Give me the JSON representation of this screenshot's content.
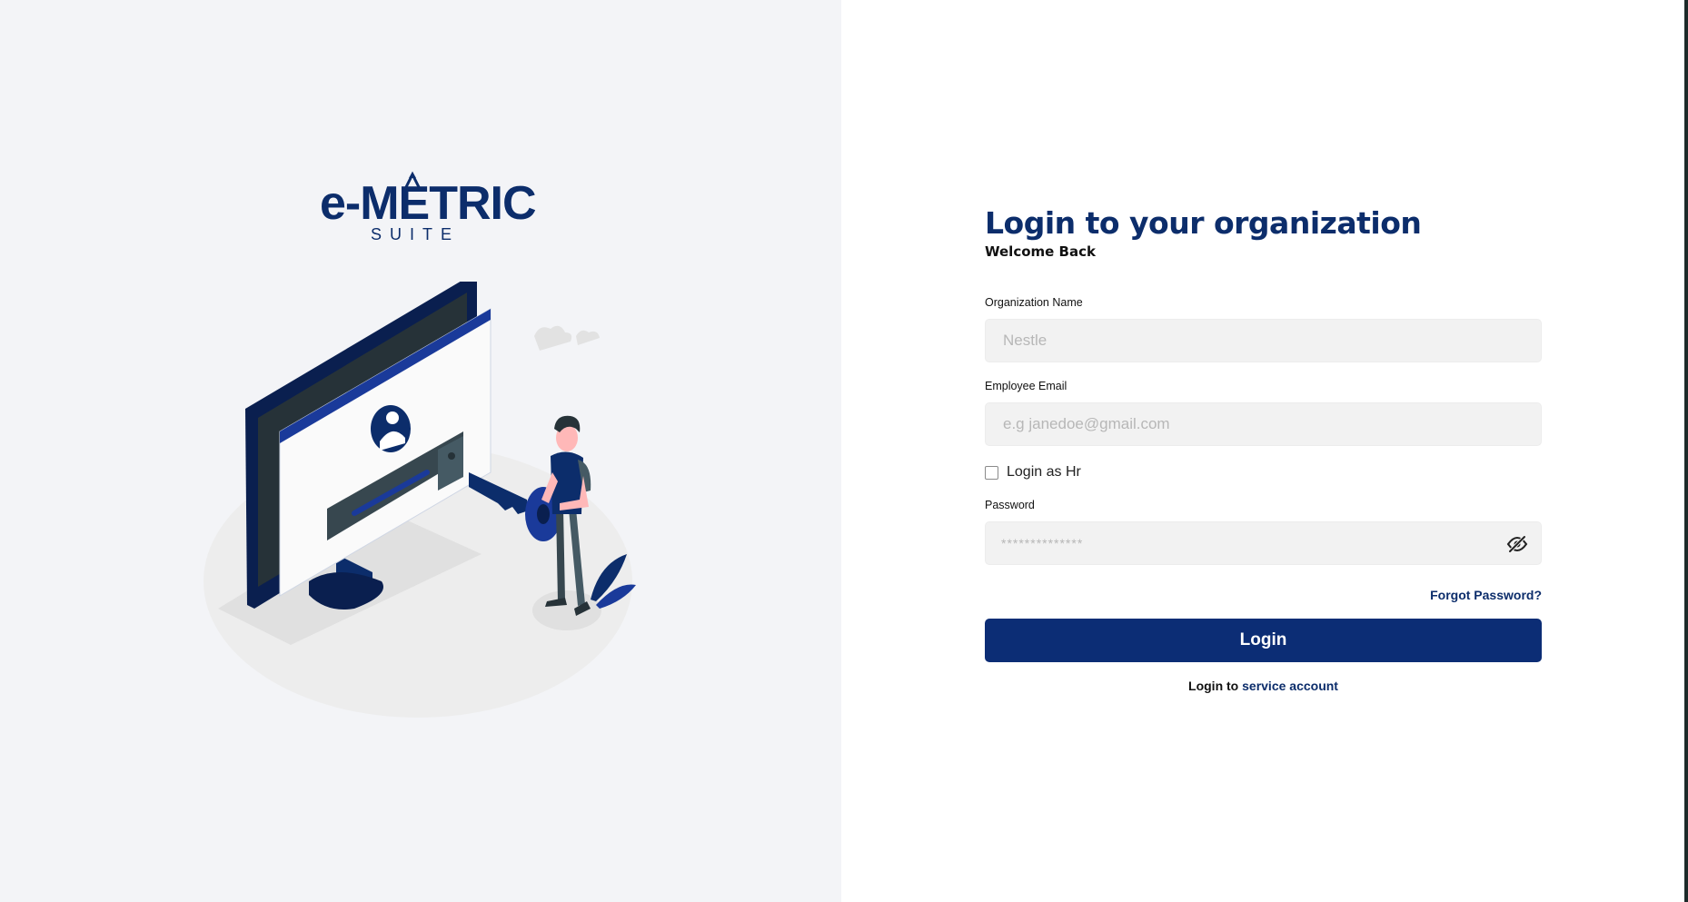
{
  "brand": {
    "logo_main": "e-METRIC",
    "logo_sub": "SUITE"
  },
  "form": {
    "title": "Login to your organization",
    "subtitle": "Welcome Back",
    "organization": {
      "label": "Organization Name",
      "placeholder": "Nestle",
      "value": ""
    },
    "email": {
      "label": "Employee Email",
      "placeholder": "e.g janedoe@gmail.com",
      "value": ""
    },
    "hr_checkbox": {
      "label": "Login as Hr",
      "checked": false
    },
    "password": {
      "label": "Password",
      "placeholder": "**************",
      "value": ""
    },
    "forgot_password": "Forgot Password?",
    "login_button": "Login",
    "service_prefix": "Login to ",
    "service_link": "service account"
  },
  "colors": {
    "primary": "#0c2d6b",
    "button": "#0c2d75",
    "left_background": "#f3f4f7",
    "input_background": "#f2f2f2"
  },
  "icons": {
    "password_toggle": "eye-slash-icon"
  }
}
